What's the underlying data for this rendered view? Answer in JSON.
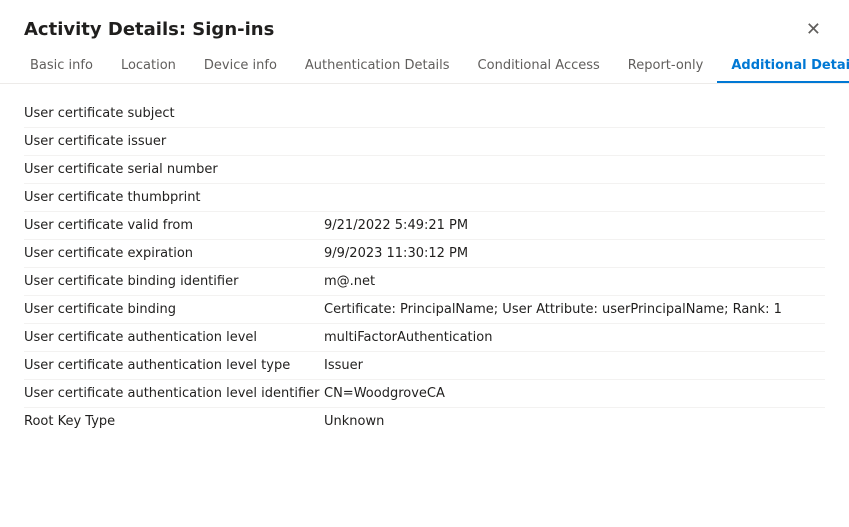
{
  "panel": {
    "title": "Activity Details: Sign-ins",
    "close_label": "✕"
  },
  "tabs": [
    {
      "id": "basic-info",
      "label": "Basic info",
      "active": false
    },
    {
      "id": "location",
      "label": "Location",
      "active": false
    },
    {
      "id": "device-info",
      "label": "Device info",
      "active": false
    },
    {
      "id": "authentication-details",
      "label": "Authentication Details",
      "active": false
    },
    {
      "id": "conditional-access",
      "label": "Conditional Access",
      "active": false
    },
    {
      "id": "report-only",
      "label": "Report-only",
      "active": false
    },
    {
      "id": "additional-details",
      "label": "Additional Details",
      "active": true
    }
  ],
  "rows": [
    {
      "label": "User certificate subject",
      "value": ""
    },
    {
      "label": "User certificate issuer",
      "value": ""
    },
    {
      "label": "User certificate serial number",
      "value": ""
    },
    {
      "label": "User certificate thumbprint",
      "value": ""
    },
    {
      "label": "User certificate valid from",
      "value": "9/21/2022 5:49:21 PM"
    },
    {
      "label": "User certificate expiration",
      "value": "9/9/2023 11:30:12 PM"
    },
    {
      "label": "User certificate binding identifier",
      "value": "m@.net"
    },
    {
      "label": "User certificate binding",
      "value": "Certificate: PrincipalName; User Attribute: userPrincipalName; Rank: 1"
    },
    {
      "label": "User certificate authentication level",
      "value": "multiFactorAuthentication"
    },
    {
      "label": "User certificate authentication level type",
      "value": "Issuer"
    },
    {
      "label": "User certificate authentication level identifier",
      "value": "CN=WoodgroveCA"
    },
    {
      "label": "Root Key Type",
      "value": "Unknown"
    }
  ]
}
